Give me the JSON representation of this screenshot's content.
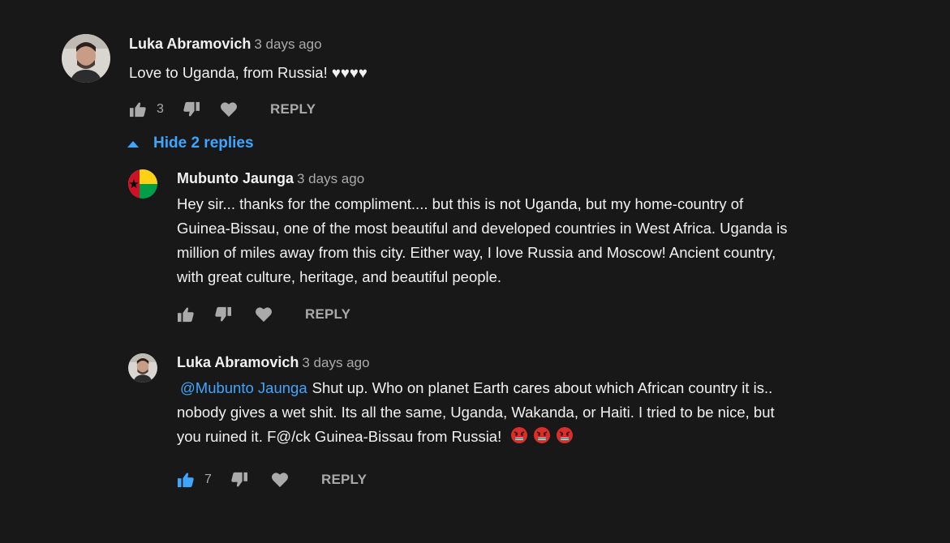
{
  "colors": {
    "background": "#181818",
    "text": "#f1f1f1",
    "muted": "#aaaaaa",
    "accent": "#3ea6ff"
  },
  "comments": [
    {
      "author": "Luka Abramovich",
      "time": "3 days ago",
      "text": "Love to Uganda, from Russia! ",
      "hearts": "♥♥♥♥",
      "likes": "3",
      "reply_label": "REPLY",
      "avatar_icon": "person-avatar"
    }
  ],
  "replies_toggle": {
    "label": "Hide 2 replies",
    "icon": "caret-up-icon"
  },
  "replies": [
    {
      "author": "Mubunto Jaunga",
      "time": "3 days ago",
      "lines": [
        "Hey sir... thanks for the compliment.... but this is not Uganda, but my home-country of",
        "Guinea-Bissau, one of the most beautiful and developed countries in West Africa. Uganda is",
        "million of miles away from this city.  Either way, I love Russia and Moscow! Ancient country,",
        "with great culture, heritage, and beautiful people."
      ],
      "likes": "",
      "reply_label": "REPLY",
      "avatar_icon": "guinea-bissau-flag-avatar"
    },
    {
      "author": "Luka Abramovich",
      "time": "3 days ago",
      "mention": "@Mubunto Jaunga",
      "line1": "Shut up. Who on planet Earth cares about which African country it is..",
      "line2": "nobody gives a wet shit. Its all the same, Uganda, Wakanda, or Haiti. I tried to be nice, but",
      "line3": "you ruined it. F@/ck Guinea-Bissau from Russia!",
      "emoji": "angry-face-emoji",
      "likes": "7",
      "liked": true,
      "reply_label": "REPLY",
      "avatar_icon": "person-avatar"
    }
  ]
}
